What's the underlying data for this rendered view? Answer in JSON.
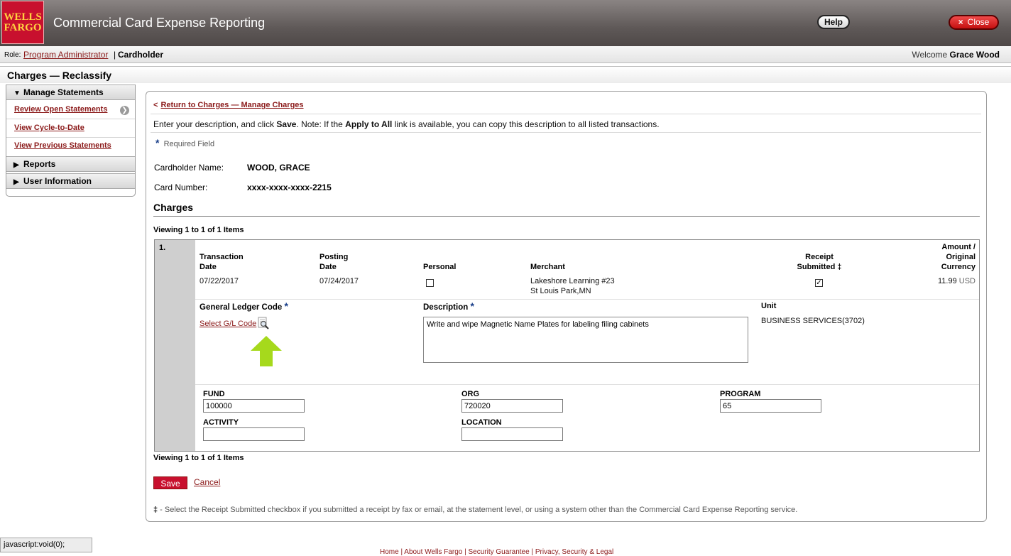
{
  "header": {
    "logo_line1": "WELLS",
    "logo_line2": "FARGO",
    "title": "Commercial Card Expense Reporting",
    "help_label": "Help",
    "close_label": "Close",
    "close_icon": "×"
  },
  "rolebar": {
    "role_label": "Role:",
    "role_admin": "Program Administrator",
    "separator": "|",
    "role_current": "Cardholder",
    "welcome_prefix": "Welcome",
    "user_name": "Grace Wood"
  },
  "page": {
    "title": "Charges — Reclassify"
  },
  "sidebar": {
    "manage_statements": "Manage Statements",
    "review_open": "Review Open Statements",
    "view_cycle": "View Cycle-to-Date",
    "view_previous": "View Previous Statements",
    "reports": "Reports",
    "user_information": "User Information",
    "expanded_icon": "▼",
    "collapsed_icon": "▶",
    "arrow_icon": "❯"
  },
  "main": {
    "return_arrow": "<",
    "return_link": "Return to Charges — Manage Charges",
    "instructions_1": "Enter your description, and click ",
    "instructions_save": "Save",
    "instructions_2": ". Note: If the ",
    "instructions_apply": "Apply to All",
    "instructions_3": " link is available, you can copy this description to all listed transactions.",
    "required_star": "*",
    "required_label": "Required Field",
    "cardholder_name_label": "Cardholder Name:",
    "cardholder_name": "WOOD, GRACE",
    "card_number_label": "Card Number:",
    "card_number": "xxxx-xxxx-xxxx-2215",
    "charges_heading": "Charges",
    "viewing": "Viewing 1 to 1 of 1 Items"
  },
  "charge": {
    "row_number": "1.",
    "headers": {
      "transaction_1": "Transaction",
      "transaction_2": "Date",
      "posting_1": "Posting",
      "posting_2": "Date",
      "personal": "Personal",
      "merchant": "Merchant",
      "receipt_1": "Receipt",
      "receipt_2": "Submitted ‡",
      "amount_1": "Amount /",
      "amount_2": "Original",
      "amount_3": "Currency"
    },
    "transaction_date": "07/22/2017",
    "posting_date": "07/24/2017",
    "personal_checked": false,
    "merchant_line1": "Lakeshore Learning #23",
    "merchant_line2": "St Louis Park,MN",
    "receipt_checked": true,
    "receipt_check_mark": "✓",
    "amount": "11.99",
    "currency": "USD",
    "gl_label": "General Ledger Code",
    "select_gl": "Select G/L Code",
    "description_label": "Description",
    "description_value": "Write and wipe Magnetic Name Plates for labeling filing cabinets",
    "unit_label": "Unit",
    "unit_value": "BUSINESS SERVICES(3702)",
    "fund_label": "FUND",
    "fund_value": "100000",
    "org_label": "ORG",
    "org_value": "720020",
    "program_label": "PROGRAM",
    "program_value": "65",
    "activity_label": "ACTIVITY",
    "activity_value": "",
    "location_label": "LOCATION",
    "location_value": ""
  },
  "actions": {
    "save": "Save",
    "cancel": "Cancel"
  },
  "footnote": {
    "mark": "‡",
    "text": " - Select the Receipt Submitted checkbox if you submitted a receipt by fax or email, at the statement level, or using a system other than the Commercial Card Expense Reporting service."
  },
  "statusbar": {
    "text": "javascript:void(0);"
  },
  "footer": {
    "links": "Home | About Wells Fargo | Security Guarantee | Privacy, Security & Legal"
  },
  "colors": {
    "brand_red": "#c8102e",
    "link": "#8b1a1a",
    "accent_green": "#a6d91c",
    "star_blue": "#1a3f8a"
  }
}
